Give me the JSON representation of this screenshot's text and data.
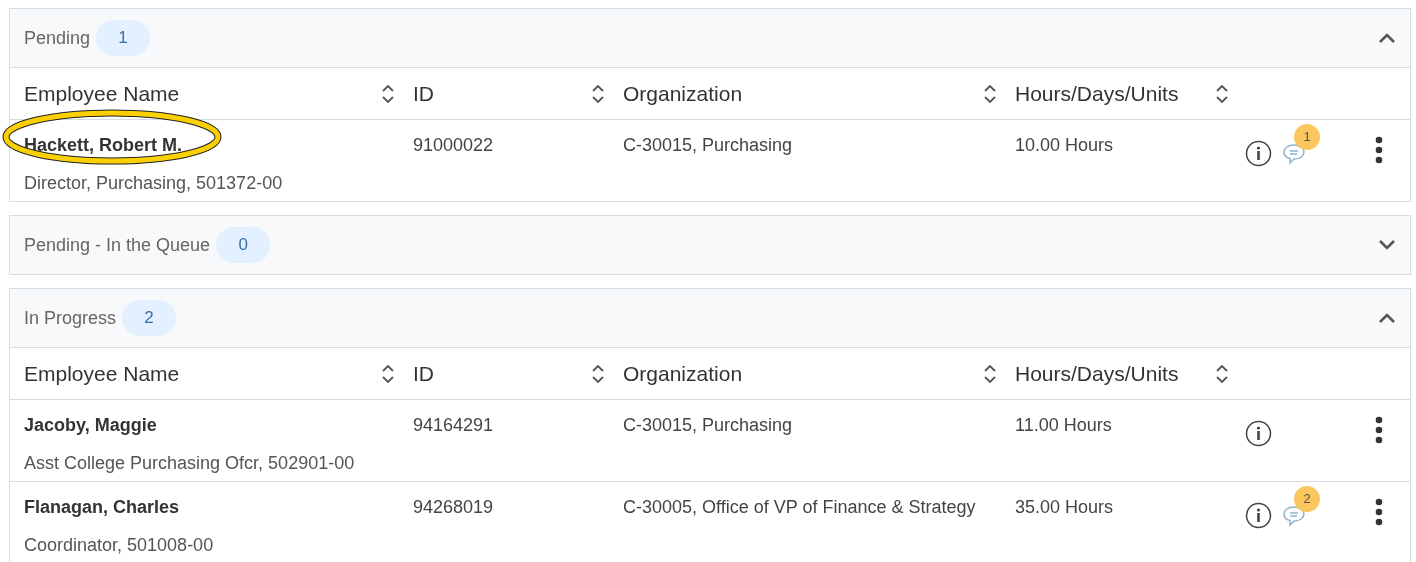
{
  "sections": [
    {
      "title": "Pending",
      "count": "1",
      "expanded": true,
      "columns": [
        "Employee Name",
        "ID",
        "Organization",
        "Hours/Days/Units"
      ],
      "rows": [
        {
          "name": "Hackett, Robert M.",
          "position": "Director, Purchasing, 501372-00",
          "id": "91000022",
          "organization": "C-30015, Purchasing",
          "amount": "10.00 Hours",
          "comments": "1",
          "highlighted": true
        }
      ]
    },
    {
      "title": "Pending - In the Queue",
      "count": "0",
      "expanded": false
    },
    {
      "title": "In Progress",
      "count": "2",
      "expanded": true,
      "columns": [
        "Employee Name",
        "ID",
        "Organization",
        "Hours/Days/Units"
      ],
      "rows": [
        {
          "name": "Jacoby, Maggie",
          "position": "Asst College Purchasing Ofcr, 502901-00",
          "id": "94164291",
          "organization": "C-30015, Purchasing",
          "amount": "11.00 Hours"
        },
        {
          "name": "Flanagan, Charles",
          "position": "Coordinator, 501008-00",
          "id": "94268019",
          "organization": "C-30005, Office of VP of Finance & Strategy",
          "amount": "35.00 Hours",
          "comments": "2"
        }
      ]
    }
  ]
}
